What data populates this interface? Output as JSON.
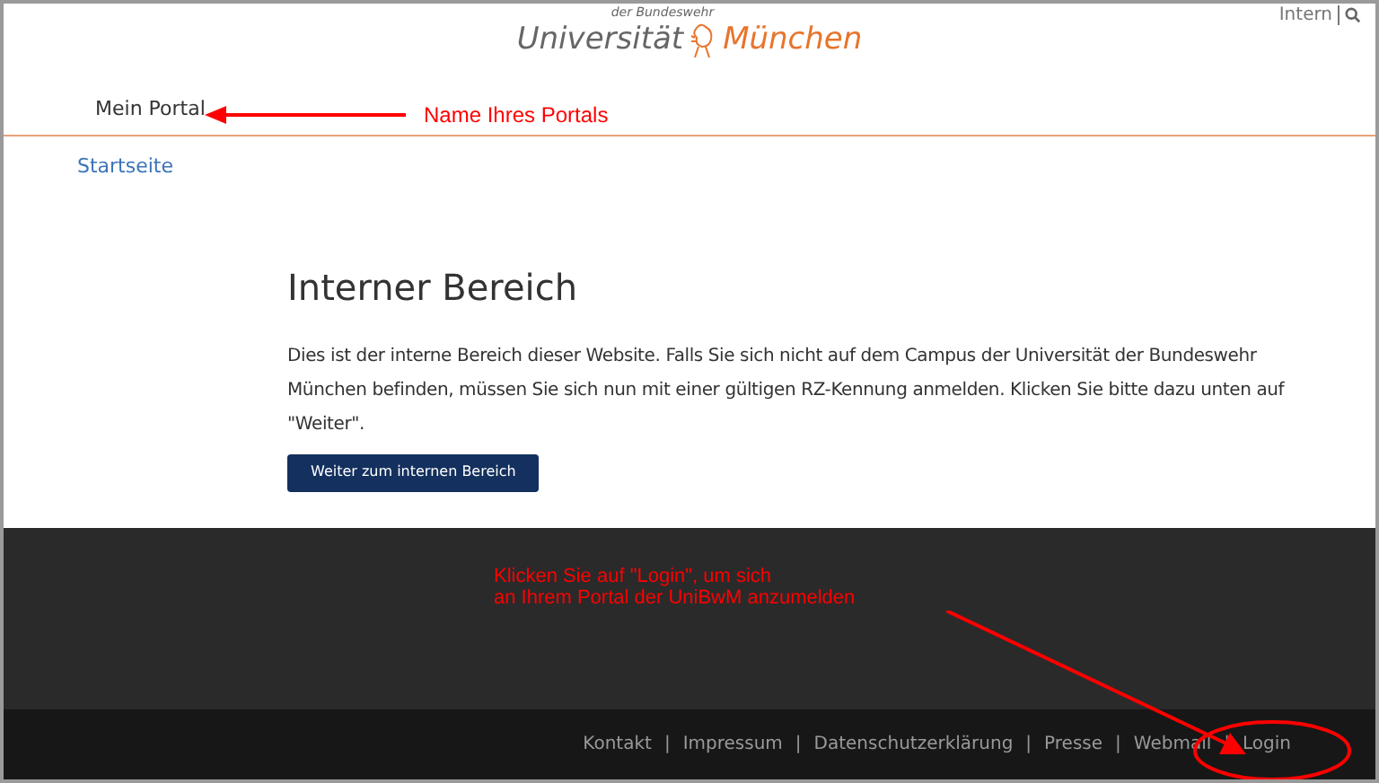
{
  "logo": {
    "tagline": "der Bundeswehr",
    "left": "Universität",
    "right": "München"
  },
  "top_links": [
    {
      "label": "Intern"
    }
  ],
  "portal_name": "Mein Portal",
  "breadcrumb": "Startseite",
  "heading": "Interner Bereich",
  "body": "Dies ist der interne Bereich dieser Website. Falls Sie sich nicht auf dem Campus der Universität der Bundeswehr München befinden, müssen Sie sich nun mit einer gültigen RZ-Kennung anmelden. Klicken Sie bitte dazu unten auf \"Weiter\".",
  "button": "Weiter zum internen Bereich",
  "footer": {
    "separator": "|",
    "links": [
      "Kontakt",
      "Impressum",
      "Datenschutzerklärung",
      "Presse",
      "Webmail",
      "Login"
    ]
  },
  "annotations": [
    {
      "kind": "label",
      "text": "Name Ihres Portals"
    },
    {
      "kind": "note",
      "lines": [
        "Klicken Sie auf \"Login\", um sich",
        "an Ihrem Portal der UniBwM anzumelden"
      ]
    }
  ]
}
